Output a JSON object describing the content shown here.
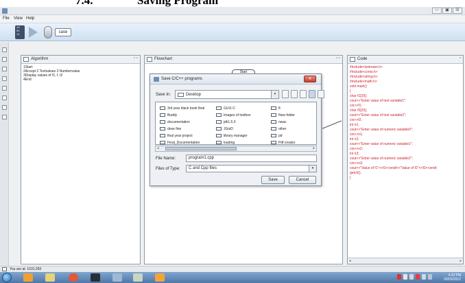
{
  "doc_heading": {
    "number": "7.4.",
    "text": "Saving Program"
  },
  "window": {
    "min_glyph": "▭",
    "max_glyph": "▣",
    "close_glyph": "☒"
  },
  "menu": {
    "items": [
      "File",
      "View",
      "Help"
    ]
  },
  "toolbar": {
    "case_label": "case"
  },
  "panels": {
    "algorithm": {
      "title": "Algorithm",
      "controls": "▫ ▫",
      "lines": [
        "1Start",
        "2Accept 2 Textvalues 3 Numbervalue",
        "3Display values of f1, f, t2",
        "4End"
      ]
    },
    "flowchart": {
      "title": "Flowchart",
      "controls": "▫ ▫",
      "start_node": "Start"
    },
    "code": {
      "title": "Code",
      "controls": "▫",
      "lines": [
        "#include<iostream.h>",
        "#include<conio.h>",
        "#include<string.h>",
        "#include<math.h>",
        "void main()",
        "{",
        "char f1[20];",
        "cout<<\"Enter value of text variable1\";",
        "cin>>f1;",
        "char f2[20];",
        "cout<<\"Enter value of text variable2\";",
        "cin>>f2;",
        "int n1;",
        "cout<<\"Enter value of numeric variable0\";",
        "cin>>n1;",
        "int n2;",
        "cout<<\"Enter value of numeric variable1\";",
        "cin>>n2;",
        "int n3;",
        "cout<<\"Enter value of numeric variable2\";",
        "cin>>n3;",
        "cout<<\"Value of f1\"<<f1<<endl<<\"Value of f2\"<<f2<<endl;",
        "getch();",
        "}"
      ]
    }
  },
  "dialog": {
    "title": "Save C/C++ programs",
    "close_glyph": "✕",
    "save_in_label": "Save In:",
    "save_in_value": "Desktop",
    "files": [
      [
        "3rd year black book final",
        "Buddy",
        "documentation",
        "dose fine",
        "final year project",
        "Final_Documentation"
      ],
      [
        "GUI1-C",
        "Images of toolbox",
        "jdk1.5.0",
        "JGoiD",
        "library manager",
        "loading"
      ],
      [
        "ft",
        "New folder",
        "nwac",
        "other",
        "pd",
        "Pdf creator"
      ]
    ],
    "file_name_label": "File Name:",
    "file_name_value": "program1.cpp",
    "file_type_label": "Files of Type:",
    "file_type_value": "C and Cpp files",
    "save_button": "Save",
    "cancel_button": "Cancel"
  },
  "status": {
    "text": "You are at: 1031:250"
  },
  "clock": {
    "time": "4:33 PM",
    "date": "20/03/2012"
  }
}
